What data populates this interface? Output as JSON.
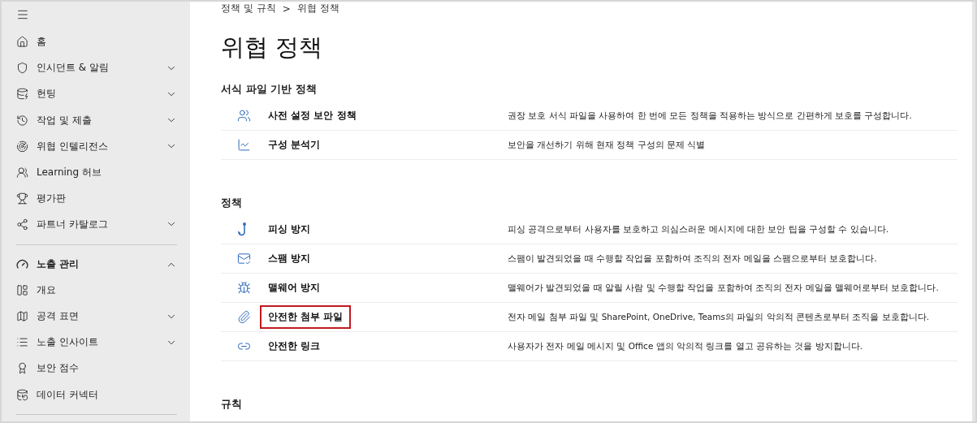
{
  "sidebar": {
    "sections": [
      {
        "items": [
          {
            "label": "홈"
          },
          {
            "label": "인시던트 & 알림",
            "expanded": false
          },
          {
            "label": "헌팅",
            "expanded": false
          },
          {
            "label": "작업 및 제출",
            "expanded": false
          },
          {
            "label": "위협 인텔리전스",
            "expanded": false
          },
          {
            "label": "Learning 허브"
          },
          {
            "label": "평가판"
          },
          {
            "label": "파트너 카탈로그",
            "expanded": false
          }
        ]
      },
      {
        "items": [
          {
            "label": "노출 관리",
            "kind": "group",
            "expanded": true
          },
          {
            "label": "개요"
          },
          {
            "label": "공격 표면",
            "expanded": false
          },
          {
            "label": "노출 인사이트",
            "expanded": false
          },
          {
            "label": "보안 점수"
          },
          {
            "label": "데이터 커넥터"
          }
        ]
      }
    ]
  },
  "breadcrumb": [
    "정책 및 규칙",
    "위협 정책"
  ],
  "breadcrumb_separator": ">",
  "title": "위협 정책",
  "sections": [
    {
      "heading": "서식 파일 기반 정책",
      "rows": [
        {
          "name": "사전 설정 보안 정책",
          "description": "권장 보호 서식 파일을 사용하여 한 번에 모든 정책을 적용하는 방식으로 간편하게 보호를 구성합니다.",
          "highlighted": false
        },
        {
          "name": "구성 분석기",
          "description": "보안을 개선하기 위해 현재 정책 구성의 문제 식별",
          "highlighted": false
        }
      ]
    },
    {
      "heading": "정책",
      "rows": [
        {
          "name": "피싱 방지",
          "description": "피싱 공격으로부터 사용자를 보호하고 의심스러운 메시지에 대한 보안 팁을 구성할 수 있습니다.",
          "highlighted": false
        },
        {
          "name": "스팸 방지",
          "description": "스팸이 발견되었을 때 수행할 작업을 포함하여 조직의 전자 메일을 스팸으로부터 보호합니다.",
          "highlighted": false
        },
        {
          "name": "맬웨어 방지",
          "description": "맬웨어가 발견되었을 때 알릴 사람 및 수행할 작업을 포함하여 조직의 전자 메일을 맬웨어로부터 보호합니다.",
          "highlighted": false
        },
        {
          "name": "안전한 첨부 파일",
          "description": "전자 메일 첨부 파일 및 SharePoint, OneDrive, Teams의 파일의 악의적 콘텐츠로부터 조직을 보호합니다.",
          "highlighted": true
        },
        {
          "name": "안전한 링크",
          "description": "사용자가 전자 메일 메시지 및 Office 앱의 악의적 링크를 열고 공유하는 것을 방지합니다.",
          "highlighted": false
        }
      ]
    },
    {
      "heading": "규칙"
    }
  ]
}
